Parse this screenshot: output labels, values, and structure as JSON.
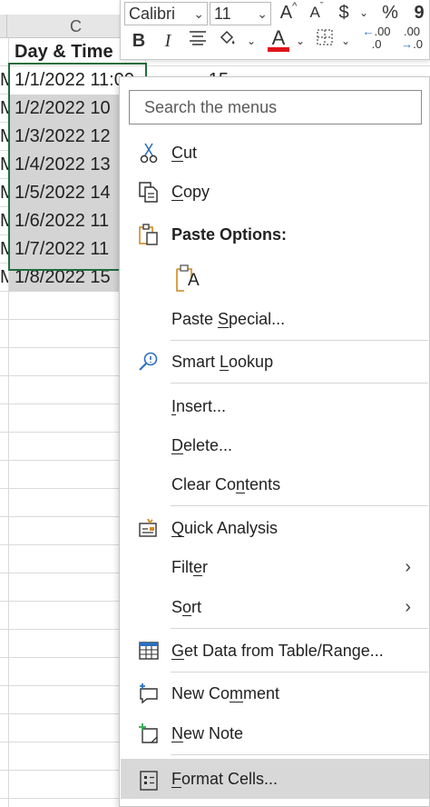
{
  "sheet": {
    "column_label": "C",
    "left_col_fragment": "M",
    "header_cell": "Day & Time",
    "value_cell": "15",
    "rows": [
      "1/1/2022 11:00",
      "1/2/2022 10",
      "1/3/2022 12",
      "1/4/2022 13",
      "1/5/2022 14",
      "1/6/2022 11",
      "1/7/2022 11",
      "1/8/2022 15"
    ]
  },
  "toolbar": {
    "font_name": "Calibri",
    "font_size": "11",
    "grow_font": "A",
    "shrink_font": "A",
    "currency": "$",
    "percent": "%",
    "comma": "9",
    "bold": "B",
    "italic": "I",
    "font_color_letter": "A",
    "inc_decimal": ".00",
    "dec_decimal": ".00",
    "font_color_hex": "#e0131a"
  },
  "menu": {
    "search_placeholder": "Search the menus",
    "items": {
      "cut": {
        "pre": "",
        "u": "C",
        "post": "ut"
      },
      "copy": {
        "pre": "",
        "u": "C",
        "post": "opy"
      },
      "paste_options": "Paste Options:",
      "paste_special": {
        "pre": "Paste ",
        "u": "S",
        "post": "pecial..."
      },
      "smart_lookup": {
        "pre": "Smart ",
        "u": "L",
        "post": "ookup"
      },
      "insert": {
        "pre": "",
        "u": "I",
        "post": "nsert..."
      },
      "delete": {
        "pre": "",
        "u": "D",
        "post": "elete..."
      },
      "clear_contents": {
        "pre": "Clear Co",
        "u": "n",
        "post": "tents"
      },
      "quick_analysis": {
        "pre": "",
        "u": "Q",
        "post": "uick Analysis"
      },
      "filter": {
        "pre": "Filt",
        "u": "e",
        "post": "r"
      },
      "sort": {
        "pre": "S",
        "u": "o",
        "post": "rt"
      },
      "get_data": {
        "pre": "",
        "u": "G",
        "post": "et Data from Table/Range..."
      },
      "new_comment": {
        "pre": "New Co",
        "u": "m",
        "post": "ment"
      },
      "new_note": {
        "pre": "",
        "u": "N",
        "post": "ew Note"
      },
      "format_cells": {
        "pre": "",
        "u": "F",
        "post": "ormat Cells..."
      }
    },
    "submenu_arrow": "›",
    "paste_icon_letter": "A"
  },
  "colors": {
    "selection_border": "#1e6e3c",
    "icon_blue": "#2b6fc0",
    "icon_orange": "#d08a1e",
    "hover": "#d8d8d8"
  }
}
